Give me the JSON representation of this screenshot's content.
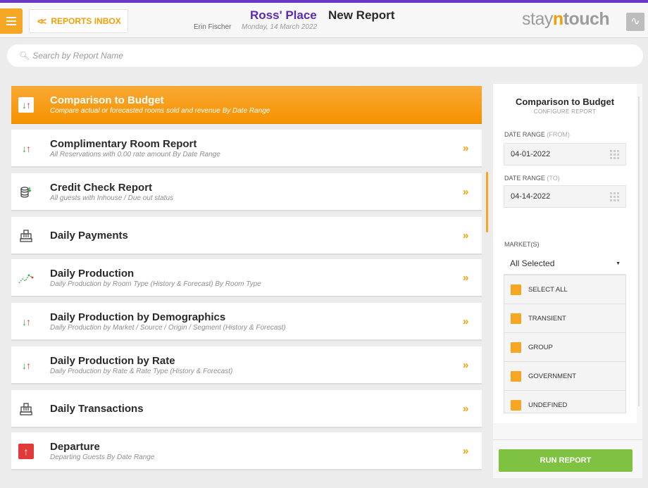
{
  "header": {
    "inbox_label": "REPORTS INBOX",
    "hotel_name": "Ross' Place",
    "page_title": "New Report",
    "user_name": "Erin Fischer",
    "date": "Monday, 14 March 2022",
    "brand_pre": "stay",
    "brand_n": "n",
    "brand_post": "touch"
  },
  "search": {
    "placeholder": "Search by Report Name"
  },
  "reports": [
    {
      "title": "Comparison to Budget",
      "desc": "Compare actual or forecasted rooms sold and revenue By Date Range",
      "icon": "arrows-icon",
      "active": true
    },
    {
      "title": "Complimentary Room Report",
      "desc": "All Reservations with 0.00 rate amount By Date Range",
      "icon": "arrows-icon"
    },
    {
      "title": "Credit Check Report",
      "desc": "All guests with Inhouse / Due out status",
      "icon": "coins-icon"
    },
    {
      "title": "Daily Payments",
      "desc": "",
      "icon": "register-icon"
    },
    {
      "title": "Daily Production",
      "desc": "Daily Production by Room Type (History & Forecast) By Room Type",
      "icon": "trend-icon"
    },
    {
      "title": "Daily Production by Demographics",
      "desc": "Daily Production by Market / Source / Origin / Segment (History & Forecast)",
      "icon": "arrows-icon"
    },
    {
      "title": "Daily Production by Rate",
      "desc": "Daily Production by Rate & Rate Type (History & Forecast)",
      "icon": "arrows-icon"
    },
    {
      "title": "Daily Transactions",
      "desc": "",
      "icon": "register-icon"
    },
    {
      "title": "Departure",
      "desc": "Departing Guests By Date Range",
      "icon": "departure-icon"
    }
  ],
  "panel": {
    "title": "Comparison to Budget",
    "subtitle": "CONFIGURE REPORT",
    "date_from_label": "DATE RANGE",
    "date_from_suffix": "(FROM)",
    "date_from_value": "04-01-2022",
    "date_to_label": "DATE RANGE",
    "date_to_suffix": "(TO)",
    "date_to_value": "04-14-2022",
    "markets_label": "MARKET(S)",
    "markets_selected": "All Selected",
    "market_options": [
      "SELECT ALL",
      "TRANSIENT",
      "GROUP",
      "GOVERNMENT",
      "UNDEFINED"
    ],
    "run_label": "RUN REPORT"
  },
  "colors": {
    "accent": "#f5a623",
    "brand_purple": "#5a2bb5",
    "run_green": "#7fc241",
    "arrow_green": "#37a64a",
    "arrow_red": "#e23a3a"
  }
}
